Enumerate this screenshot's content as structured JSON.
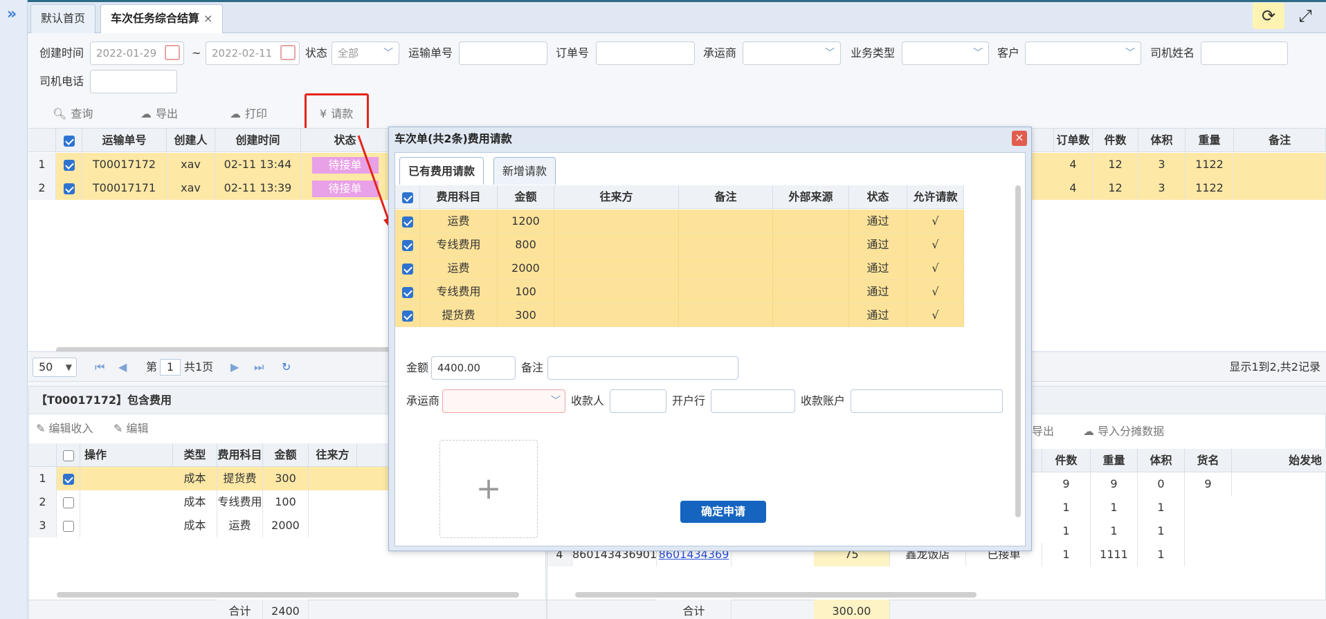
{
  "top_tabs": [
    {
      "label": "默认首页"
    },
    {
      "label": "车次任务综合结算",
      "close": "×"
    }
  ],
  "filters": {
    "created_label": "创建时间",
    "date_from": "2022-01-29",
    "tilde": "~",
    "date_to": "2022-02-11",
    "status_label": "状态",
    "status_value": "全部",
    "transport_no_label": "运输单号",
    "order_no_label": "订单号",
    "carrier_label": "承运商",
    "business_type_label": "业务类型",
    "customer_label": "客户",
    "driver_name_label": "司机姓名",
    "driver_phone_label": "司机电话"
  },
  "toolbar": {
    "query": "查询",
    "export": "导出",
    "print": "打印",
    "request": "请款"
  },
  "main_grid": {
    "headers": {
      "transport_no": "运输单号",
      "creator": "创建人",
      "created": "创建时间",
      "status": "状态",
      "order_count": "订单数",
      "pieces": "件数",
      "volume": "体积",
      "weight": "重量",
      "remark": "备注"
    },
    "rows": [
      {
        "idx": "1",
        "transport_no": "T00017172",
        "creator": "xav",
        "created": "02-11 13:44",
        "status": "待接单",
        "order_count": "4",
        "pieces": "12",
        "volume": "3",
        "weight": "1122"
      },
      {
        "idx": "2",
        "transport_no": "T00017171",
        "creator": "xav",
        "created": "02-11 13:39",
        "status": "待接单",
        "order_count": "4",
        "pieces": "12",
        "volume": "3",
        "weight": "1122"
      }
    ]
  },
  "pager": {
    "page_size": "50",
    "page_prefix": "第",
    "page_value": "1",
    "page_suffix": "共1页",
    "summary": "显示1到2,共2记录"
  },
  "lower_left": {
    "title": "【T00017172】包含费用",
    "edit_income": "编辑收入",
    "edit": "编辑",
    "headers": {
      "op": "操作",
      "type": "类型",
      "item": "费用科目",
      "amount": "金额",
      "party": "往来方"
    },
    "rows": [
      {
        "idx": "1",
        "checked": true,
        "type": "成本",
        "item": "提货费",
        "amount": "300"
      },
      {
        "idx": "2",
        "checked": false,
        "type": "成本",
        "item": "专线费用",
        "amount": "100"
      },
      {
        "idx": "3",
        "checked": false,
        "type": "成本",
        "item": "运费",
        "amount": "2000"
      }
    ],
    "total_label": "合计",
    "total_value": "2400"
  },
  "lower_right": {
    "export": "导出",
    "import_split": "导入分摊数据",
    "headers": {
      "pieces": "件数",
      "weight": "重量",
      "volume": "体积",
      "goods": "货名",
      "origin": "始发地"
    },
    "rows": [
      {
        "pieces": "9",
        "weight": "9",
        "volume": "0",
        "goods": "9"
      },
      {
        "pieces": "1",
        "weight": "1",
        "volume": "1",
        "goods": ""
      },
      {
        "pieces": "1",
        "weight": "1",
        "volume": "1",
        "goods": ""
      },
      {
        "idx": "4",
        "code1": "860143436901",
        "code2": "8601434369",
        "amount": "75",
        "place": "鑫龙饭店",
        "status": "已接单",
        "pieces": "1",
        "weight": "1111",
        "volume": "1"
      }
    ],
    "total_label": "合计",
    "total_value": "300.00"
  },
  "dialog": {
    "title": "车次单(共2条)费用请款",
    "close": "×",
    "tabs": [
      {
        "label": "已有费用请款"
      },
      {
        "label": "新增请款"
      }
    ],
    "headers": {
      "item": "费用科目",
      "amount": "金额",
      "party": "往来方",
      "remark": "备注",
      "source": "外部来源",
      "status": "状态",
      "allow": "允许请款"
    },
    "rows": [
      {
        "item": "运费",
        "amount": "1200",
        "status": "通过",
        "allow": "√"
      },
      {
        "item": "专线费用",
        "amount": "800",
        "status": "通过",
        "allow": "√"
      },
      {
        "item": "运费",
        "amount": "2000",
        "status": "通过",
        "allow": "√"
      },
      {
        "item": "专线费用",
        "amount": "100",
        "status": "通过",
        "allow": "√"
      },
      {
        "item": "提货费",
        "amount": "300",
        "status": "通过",
        "allow": "√"
      }
    ],
    "amount_label": "金额",
    "amount_value": "4400.00",
    "remark_label": "备注",
    "carrier_label": "承运商",
    "payee_label": "收款人",
    "bank_label": "开户行",
    "account_label": "收款账户",
    "upload_plus": "+",
    "submit": "确定申请"
  },
  "colors": {
    "accent": "#1565c0",
    "highlight_row": "#fde8a6",
    "badge": "#e8a0e6",
    "annotation": "#e4241b"
  }
}
